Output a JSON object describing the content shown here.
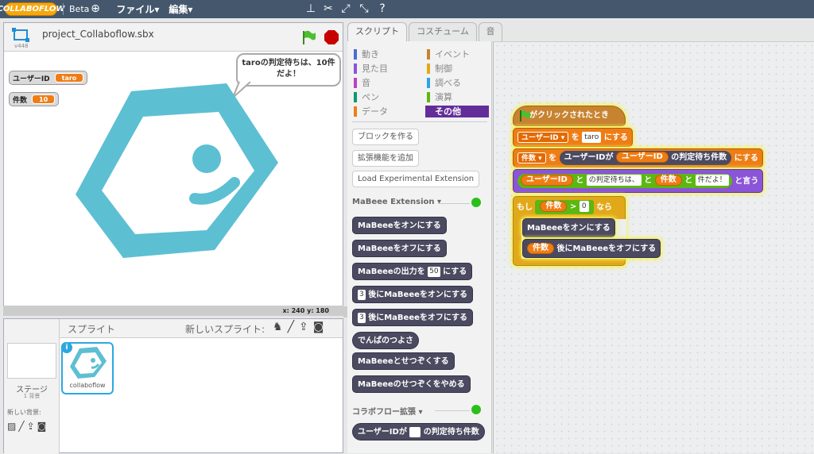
{
  "topbar": {
    "logo": "COLLABOFLOW",
    "beta": "Beta",
    "file_menu": "ファイル▾",
    "edit_menu": "編集▾"
  },
  "stage": {
    "project_title": "project_Collaboflow.sbx",
    "version": "v448",
    "bubble": "taroの判定待ちは、10件だよ！",
    "watchers": [
      {
        "label": "ユーザーID",
        "value": "taro"
      },
      {
        "label": "件数",
        "value": "10"
      }
    ],
    "coords": "x: 240  y: 180"
  },
  "sprites": {
    "header": "スプライト",
    "new_sprite": "新しいスプライト:",
    "stage_label": "ステージ",
    "stage_sub": "1 背景",
    "new_backdrop": "新しい背景:",
    "sprite_name": "collaboflow"
  },
  "tabs": [
    "スクリプト",
    "コスチューム",
    "音"
  ],
  "categories": [
    {
      "label": "動き",
      "color": "#4a6cd4"
    },
    {
      "label": "イベント",
      "color": "#c88330"
    },
    {
      "label": "見た目",
      "color": "#8a55d7"
    },
    {
      "label": "制御",
      "color": "#e1a91a"
    },
    {
      "label": "音",
      "color": "#bb42c3"
    },
    {
      "label": "調べる",
      "color": "#2ca5e2"
    },
    {
      "label": "ペン",
      "color": "#0e9a6c"
    },
    {
      "label": "演算",
      "color": "#5cb712"
    },
    {
      "label": "データ",
      "color": "#ee7d16"
    },
    {
      "label": "その他",
      "color": "#632d99"
    }
  ],
  "palette": {
    "make_block": "ブロックを作る",
    "add_ext": "拡張機能を追加",
    "load_exp": "Load Experimental Extension",
    "mabeee_ext": "MaBeee Extension ▾",
    "blocks": [
      "MaBeeeをオンにする",
      "MaBeeeをオフにする",
      "MaBeeeの出力を",
      "にする",
      "後にMaBeeeをオンにする",
      "後にMaBeeeをオフにする",
      "でんぱのつよさ",
      "MaBeeeとせつぞくする",
      "MaBeeeのせつぞくをやめる"
    ],
    "mabeee_output_val": "50",
    "sec_val": "3",
    "collab_ext": "コラボフロー拡張 ▾",
    "collab_block_a": "ユーザーIDが",
    "collab_block_b": "の判定待ち件数"
  },
  "script": {
    "hat": "がクリックされたとき",
    "set1": {
      "var": "ユーザーID",
      "to": "を",
      "value": "taro",
      "end": "にする"
    },
    "set2": {
      "var": "件数",
      "to": "を",
      "r1": "ユーザーIDが",
      "r2": "ユーザーID",
      "r3": "の判定待ち件数",
      "end": "にする"
    },
    "say": {
      "a": "ユーザーID",
      "and1": "と",
      "b": "の判定待ちは、",
      "and2": "と",
      "c": "件数",
      "and3": "と",
      "d": "件だよ！",
      "end": "と言う"
    },
    "if": {
      "kw": "もし",
      "var": "件数",
      "op": ">",
      "val": "0",
      "then": "なら"
    },
    "on": "MaBeeeをオンにする",
    "off": {
      "var": "件数",
      "text": "後にMaBeeeをオフにする"
    }
  }
}
